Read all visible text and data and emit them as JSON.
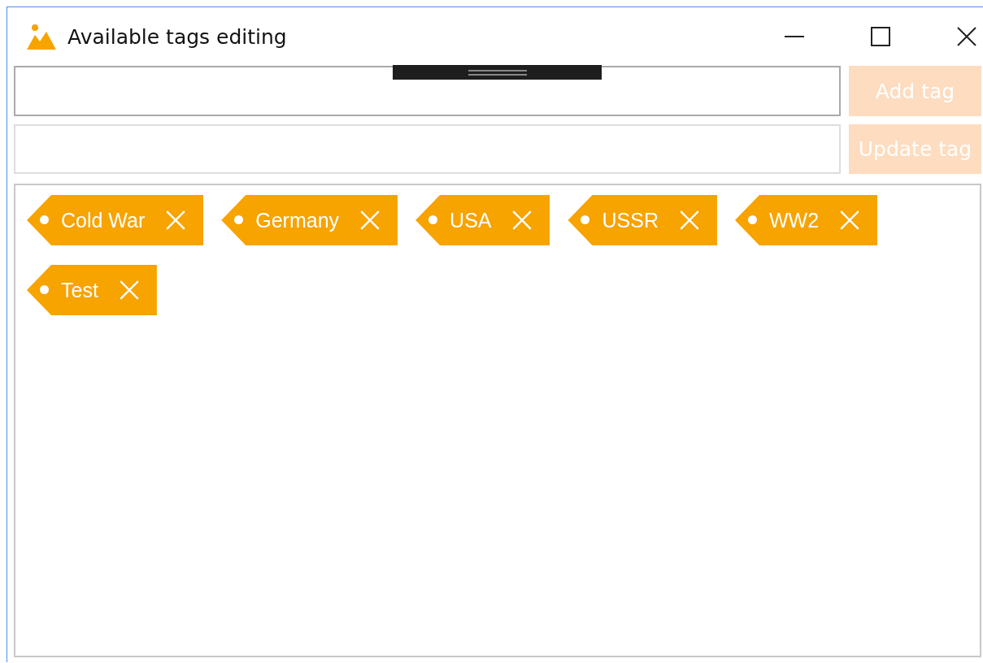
{
  "window": {
    "title": "Available tags editing"
  },
  "fields": [
    {
      "button": {
        "label": "Add tag",
        "disabled": true
      }
    },
    {
      "button": {
        "label": "Update tag",
        "disabled": true
      }
    }
  ],
  "tags": [
    {
      "label": "Cold War"
    },
    {
      "label": "Germany"
    },
    {
      "label": "USA"
    },
    {
      "label": "USSR"
    },
    {
      "label": "WW2"
    },
    {
      "label": "Test"
    }
  ]
}
